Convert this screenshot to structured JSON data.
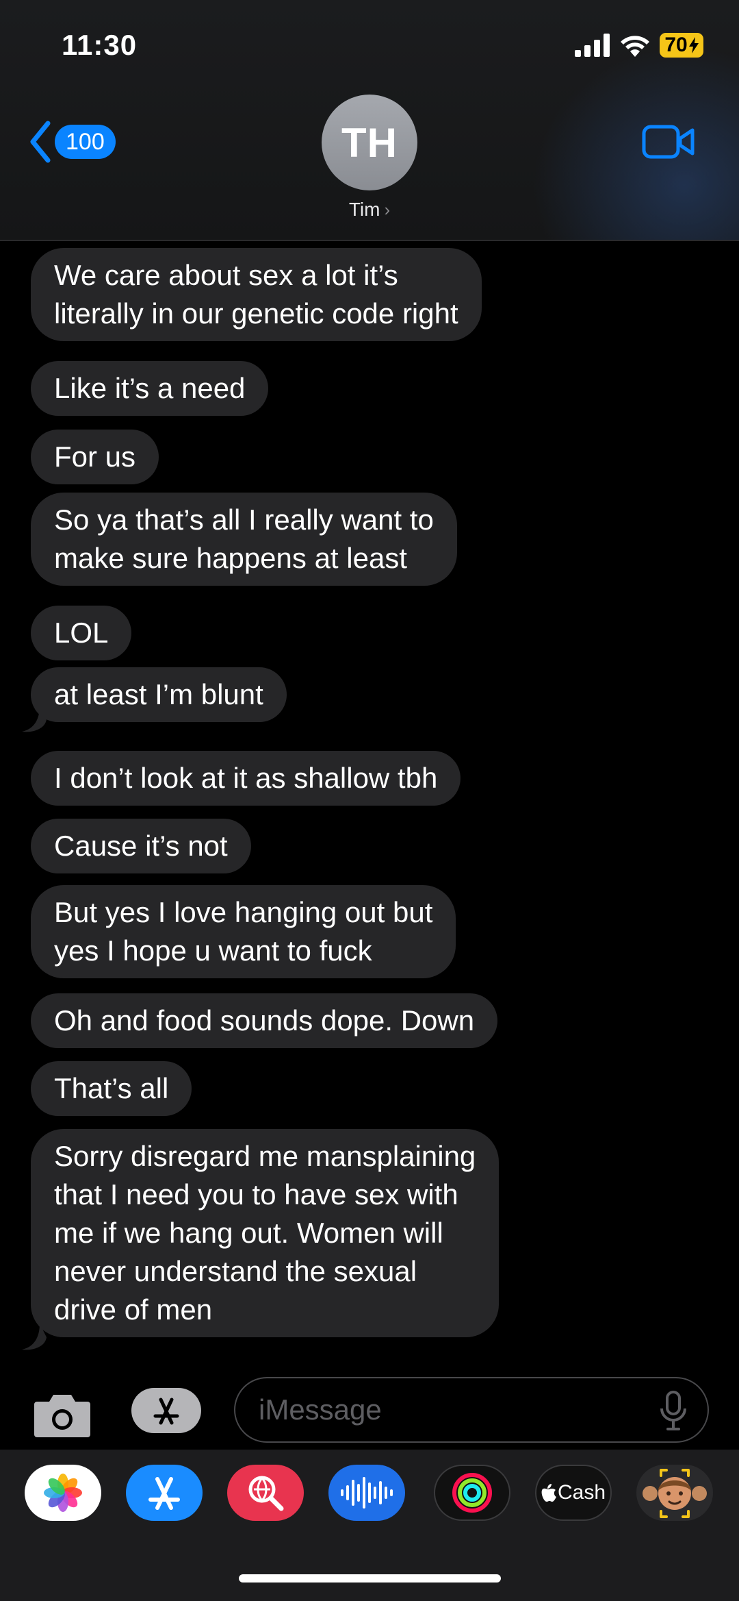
{
  "status_bar": {
    "time": "11:30",
    "battery": "70"
  },
  "nav": {
    "back_count": "100",
    "contact_initials": "TH",
    "contact_name": "Tim"
  },
  "messages": [
    {
      "text": "We care about sex a lot it’s\nliterally in our genetic code right"
    },
    {
      "text": "Like it’s a need"
    },
    {
      "text": "For us"
    },
    {
      "text": "So ya that’s all I really want to\nmake sure happens at least"
    },
    {
      "text": "LOL"
    },
    {
      "text": "at least I’m blunt"
    },
    {
      "text": " I don’t look at it as shallow tbh"
    },
    {
      "text": "Cause it’s not"
    },
    {
      "text": "But yes I love hanging out but\nyes I hope u want to fuck"
    },
    {
      "text": "Oh and food sounds dope. Down"
    },
    {
      "text": "That’s all"
    },
    {
      "text": "Sorry disregard me mansplaining\nthat I need you to have sex with\nme if we hang out. Women will\nnever understand the sexual\ndrive of men"
    }
  ],
  "composer": {
    "placeholder": "iMessage"
  },
  "app_drawer": {
    "apps": [
      {
        "icon": "photos-icon"
      },
      {
        "icon": "app-store-icon"
      },
      {
        "icon": "web-search-icon"
      },
      {
        "icon": "audio-message-icon"
      },
      {
        "icon": "activity-icon"
      },
      {
        "icon": "apple-cash-icon",
        "label": "Cash"
      },
      {
        "icon": "memoji-icon"
      }
    ]
  },
  "colors": {
    "accent": "#0a84ff",
    "bubble_incoming": "#262628",
    "battery": "#f5c518"
  }
}
